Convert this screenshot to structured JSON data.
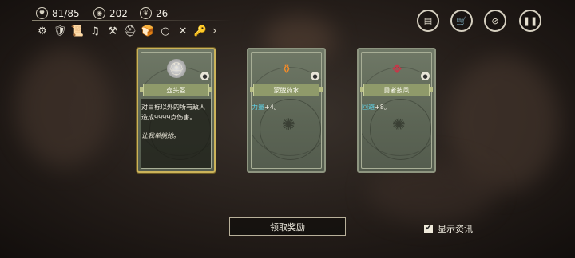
{
  "stats": {
    "hp": "81/85",
    "gold": "202",
    "energy": "26"
  },
  "relics": [
    {
      "icon": "gear-icon",
      "glyph": "⚙"
    },
    {
      "icon": "shield-icon",
      "glyph": "🛡"
    },
    {
      "icon": "scroll-icon",
      "glyph": "📜"
    },
    {
      "icon": "note-icon",
      "glyph": "♫"
    },
    {
      "icon": "axe-icon",
      "glyph": "⚒"
    },
    {
      "icon": "helmet-icon",
      "glyph": "⛑"
    },
    {
      "icon": "bread-icon",
      "glyph": "🍞"
    },
    {
      "icon": "ring-icon",
      "glyph": "○"
    },
    {
      "icon": "bone-icon",
      "glyph": "✕"
    },
    {
      "icon": "key-icon",
      "glyph": "🔑"
    }
  ],
  "topbar": {
    "map_icon": "map-icon",
    "shop_icon": "cart-icon",
    "settings_icon": "no-sound-icon",
    "pause_icon": "pause-icon"
  },
  "cards": [
    {
      "name": "壶头盔",
      "item_icon": "helmet-item-icon",
      "desc_lines": [
        "对目标以外的所有敌人",
        "造成9999点伤害。"
      ],
      "flavor": "让我单挑她。",
      "selected": true
    },
    {
      "name": "蒙脱药水",
      "item_icon": "potion-item-icon",
      "stat_key": "力量",
      "stat_value": "+4。",
      "selected": false
    },
    {
      "name": "勇者披风",
      "item_icon": "cloak-item-icon",
      "stat_key": "回避",
      "stat_value": "+8。",
      "selected": false
    }
  ],
  "claim_label": "领取奖励",
  "show_info_label": "显示资讯",
  "show_info_checked": true,
  "colors": {
    "accent_gold": "#cbb35a",
    "stat_cyan": "#5fd3e8",
    "card_green": "#6f7866"
  }
}
